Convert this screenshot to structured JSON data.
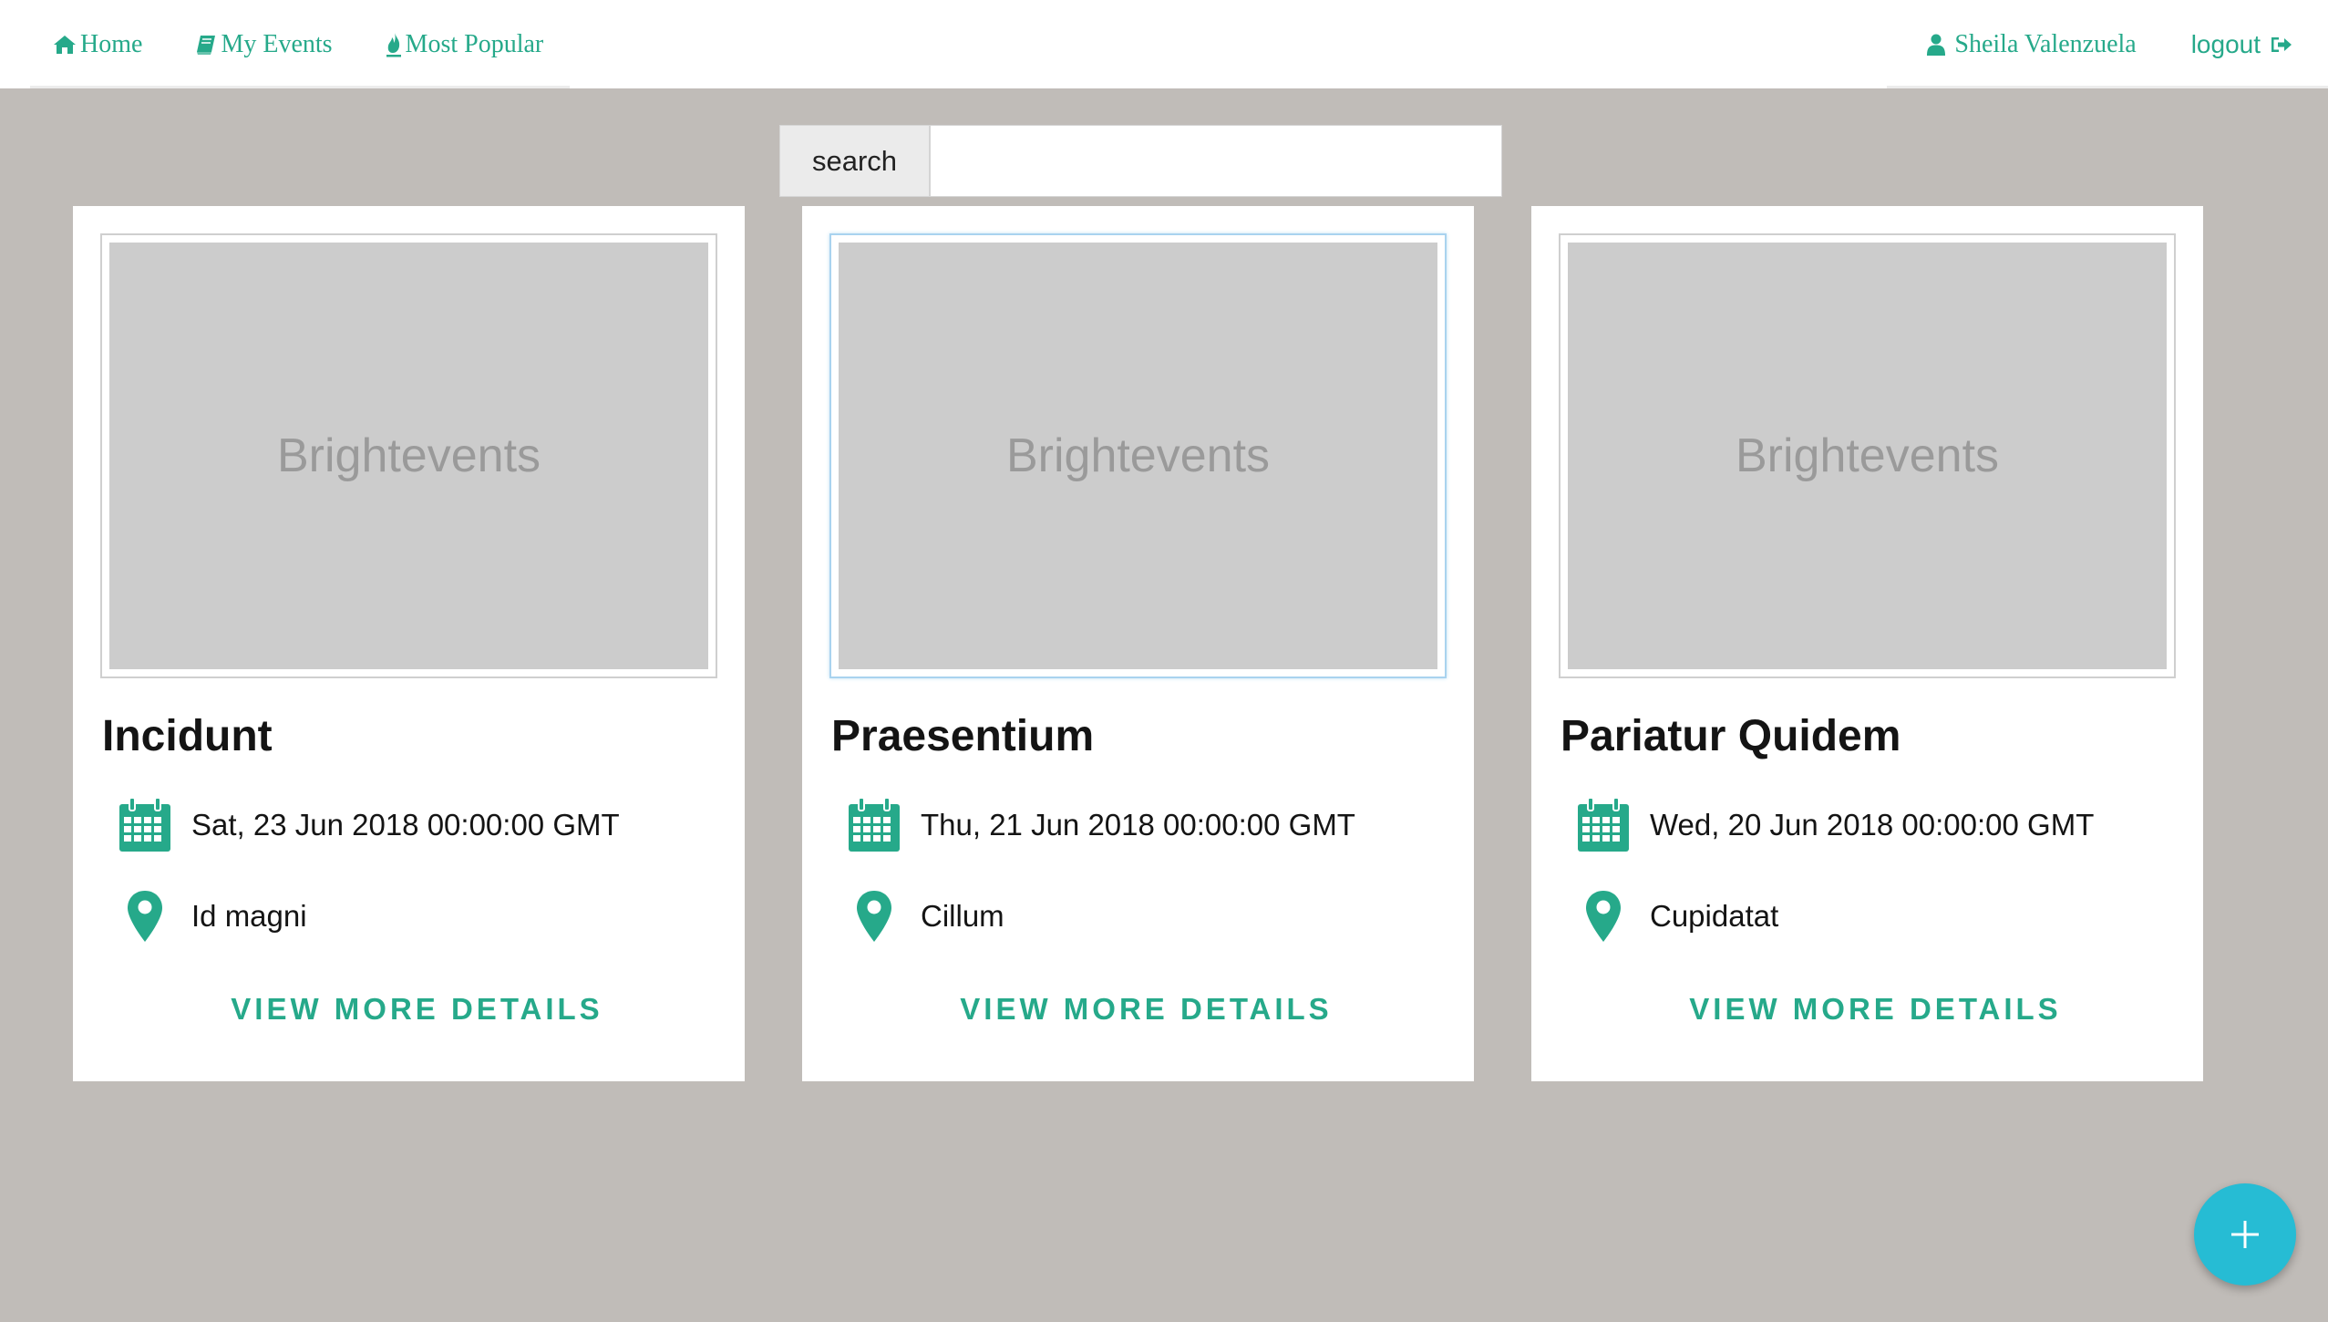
{
  "nav": {
    "home": "Home",
    "my_events": "My Events",
    "most_popular": "Most Popular",
    "user_name": "Sheila Valenzuela",
    "logout": "logout"
  },
  "search": {
    "label": "search",
    "value": ""
  },
  "events": [
    {
      "image_text": "Brightevents",
      "title": "Incidunt",
      "date": "Sat, 23 Jun 2018 00:00:00 GMT",
      "location": "Id magni",
      "link": "VIEW MORE DETAILS"
    },
    {
      "image_text": "Brightevents",
      "title": "Praesentium",
      "date": "Thu, 21 Jun 2018 00:00:00 GMT",
      "location": "Cillum",
      "link": "VIEW MORE DETAILS"
    },
    {
      "image_text": "Brightevents",
      "title": "Pariatur Quidem",
      "date": "Wed, 20 Jun 2018 00:00:00 GMT",
      "location": "Cupidatat",
      "link": "VIEW MORE DETAILS"
    }
  ],
  "fab": {
    "icon": "plus-icon",
    "symbol": "+"
  },
  "colors": {
    "accent": "#26a98a",
    "background": "#c0bcb8",
    "fab": "#26bcd4",
    "placeholder": "#cccccc"
  }
}
